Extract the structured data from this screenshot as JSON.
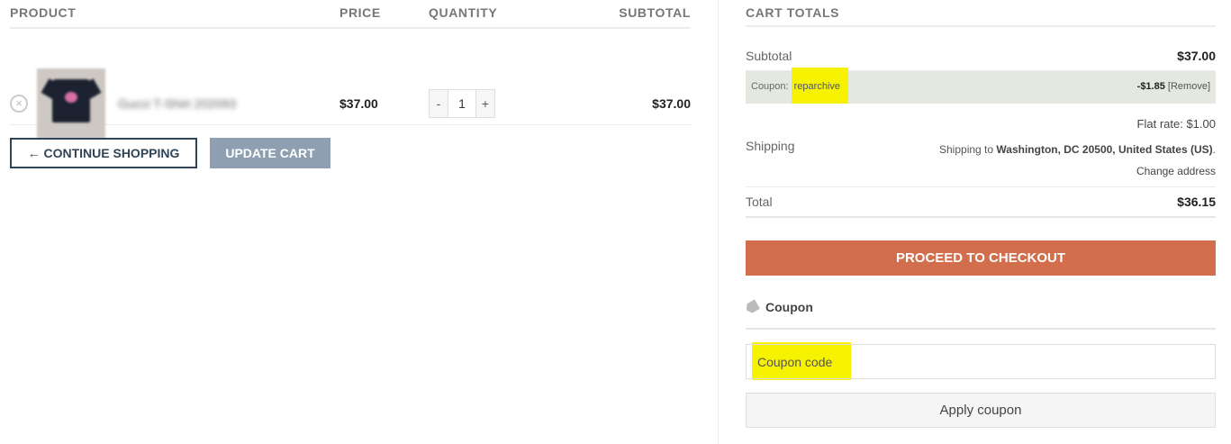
{
  "cart": {
    "headers": {
      "product": "PRODUCT",
      "price": "PRICE",
      "quantity": "QUANTITY",
      "subtotal": "SUBTOTAL"
    },
    "items": [
      {
        "name": "Gucci T-Shirt 202093",
        "price": "$37.00",
        "quantity": "1",
        "subtotal": "$37.00"
      }
    ],
    "remove_glyph": "×",
    "qty_minus": "-",
    "qty_plus": "+",
    "continue_label": "← CONTINUE SHOPPING",
    "update_label": "UPDATE CART"
  },
  "totals": {
    "title": "CART TOTALS",
    "subtotal_label": "Subtotal",
    "subtotal_value": "$37.00",
    "coupon_label": "Coupon:",
    "coupon_code": "reparchive",
    "coupon_amount": "-$1.85",
    "coupon_remove": "[Remove]",
    "flat_rate_label": "Flat rate:",
    "flat_rate_value": "$1.00",
    "shipping_label": "Shipping",
    "shipping_to_prefix": "Shipping to",
    "shipping_address": "Washington, DC 20500, United States (US)",
    "shipping_suffix": ".",
    "change_address": "Change address",
    "total_label": "Total",
    "total_value": "$36.15",
    "checkout_label": "PROCEED TO CHECKOUT"
  },
  "coupon": {
    "title": "Coupon",
    "placeholder": "Coupon code",
    "apply_label": "Apply coupon",
    "icon": "tag-icon"
  },
  "colors": {
    "checkout": "#d26e4b",
    "update_button": "#8d9fb0",
    "continue_border": "#2f4456",
    "highlight": "#f7f200",
    "coupon_row_bg": "#e4e9df"
  }
}
